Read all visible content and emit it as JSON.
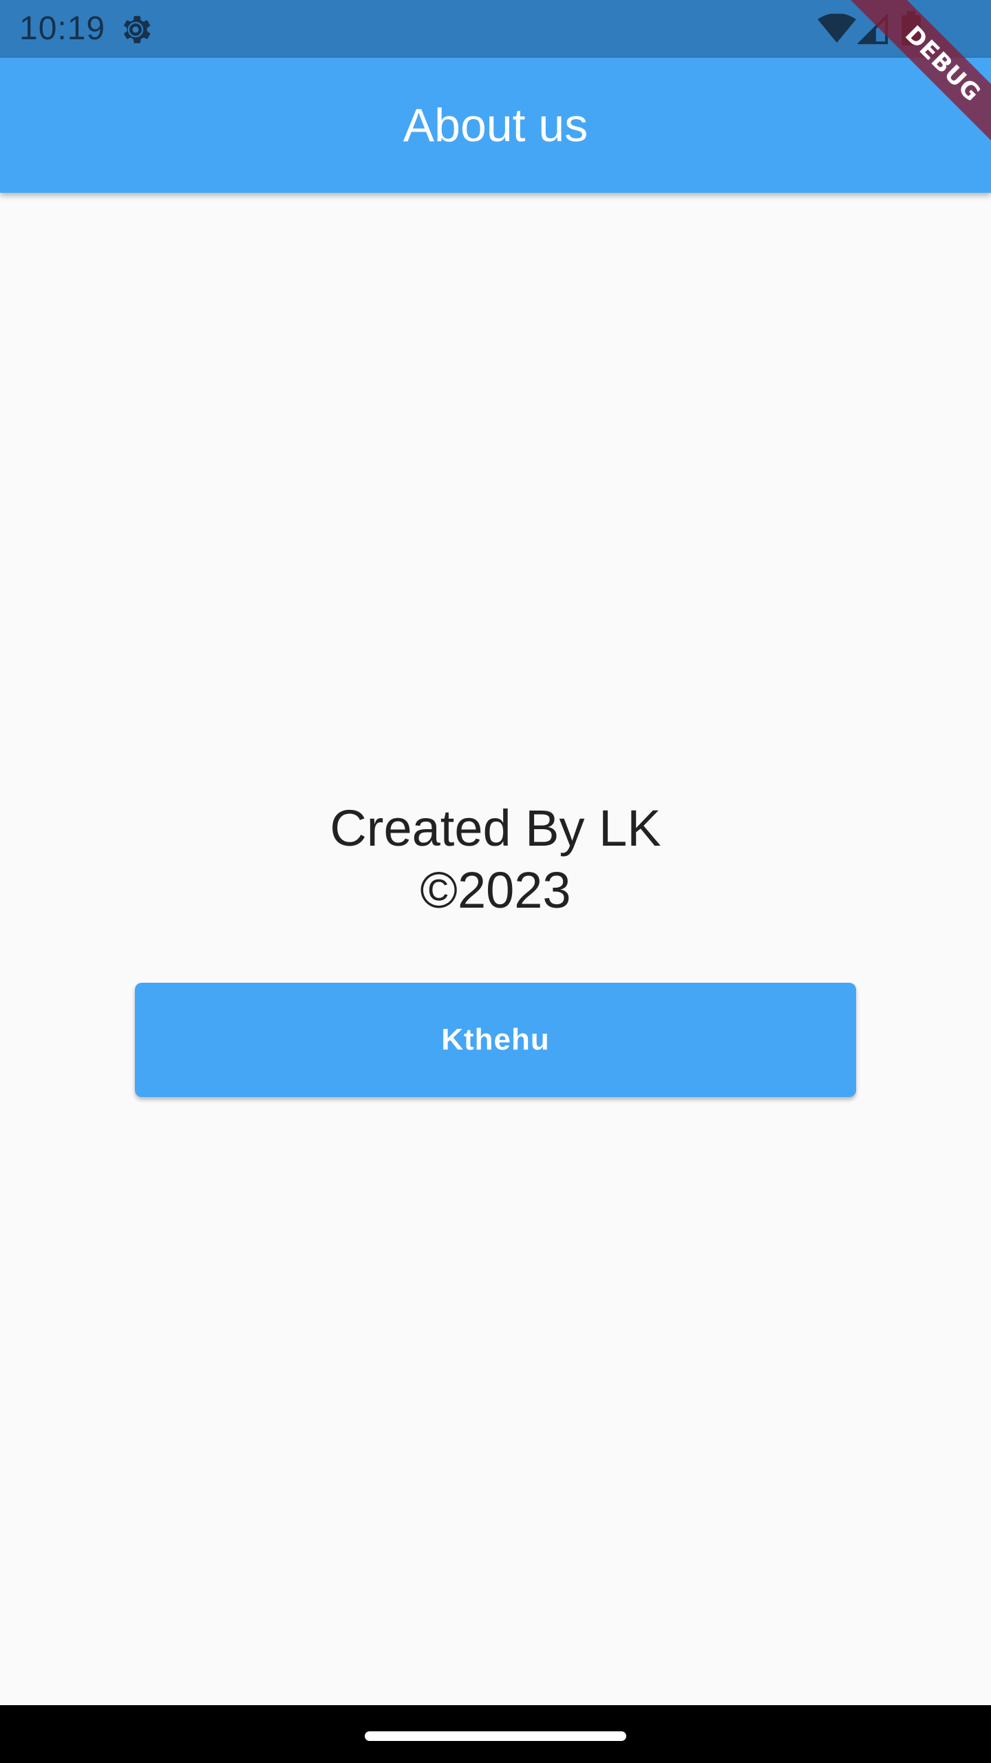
{
  "status_bar": {
    "time": "10:19",
    "icons": {
      "settings": "gear-icon",
      "wifi": "wifi-icon",
      "signal": "signal-icon",
      "battery": "battery-icon"
    }
  },
  "app_bar": {
    "title": "About us"
  },
  "debug_banner": {
    "label": "DEBUG"
  },
  "content": {
    "credit_line": "Created By LK",
    "copyright_line": "©2023",
    "button_label": "Kthehu"
  },
  "colors": {
    "status_bar": "#317cbd",
    "app_bar": "#45a6f5",
    "button": "#45a6f5",
    "background": "#fafafa",
    "debug_banner": "#851c34"
  }
}
